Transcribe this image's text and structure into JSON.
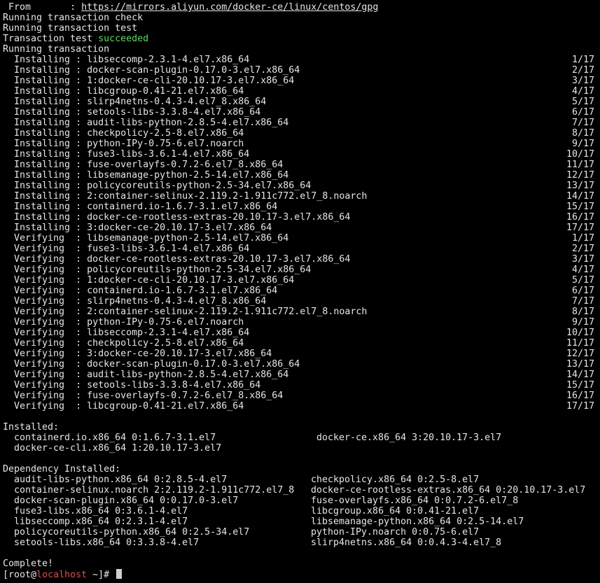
{
  "header_lines": {
    "from_label": " From       : ",
    "from_url": "https://mirrors.aliyun.com/docker-ce/linux/centos/gpg",
    "check": "Running transaction check",
    "test": "Running transaction test",
    "result_prefix": "Transaction test ",
    "result_status": "succeeded",
    "running": "Running transaction"
  },
  "transaction": [
    {
      "action": "Installing",
      "package": "libseccomp-2.3.1-4.el7.x86_64",
      "count": "1/17"
    },
    {
      "action": "Installing",
      "package": "docker-scan-plugin-0.17.0-3.el7.x86_64",
      "count": "2/17"
    },
    {
      "action": "Installing",
      "package": "1:docker-ce-cli-20.10.17-3.el7.x86_64",
      "count": "3/17"
    },
    {
      "action": "Installing",
      "package": "libcgroup-0.41-21.el7.x86_64",
      "count": "4/17"
    },
    {
      "action": "Installing",
      "package": "slirp4netns-0.4.3-4.el7_8.x86_64",
      "count": "5/17"
    },
    {
      "action": "Installing",
      "package": "setools-libs-3.3.8-4.el7.x86_64",
      "count": "6/17"
    },
    {
      "action": "Installing",
      "package": "audit-libs-python-2.8.5-4.el7.x86_64",
      "count": "7/17"
    },
    {
      "action": "Installing",
      "package": "checkpolicy-2.5-8.el7.x86_64",
      "count": "8/17"
    },
    {
      "action": "Installing",
      "package": "python-IPy-0.75-6.el7.noarch",
      "count": "9/17"
    },
    {
      "action": "Installing",
      "package": "fuse3-libs-3.6.1-4.el7.x86_64",
      "count": "10/17"
    },
    {
      "action": "Installing",
      "package": "fuse-overlayfs-0.7.2-6.el7_8.x86_64",
      "count": "11/17"
    },
    {
      "action": "Installing",
      "package": "libsemanage-python-2.5-14.el7.x86_64",
      "count": "12/17"
    },
    {
      "action": "Installing",
      "package": "policycoreutils-python-2.5-34.el7.x86_64",
      "count": "13/17"
    },
    {
      "action": "Installing",
      "package": "2:container-selinux-2.119.2-1.911c772.el7_8.noarch",
      "count": "14/17"
    },
    {
      "action": "Installing",
      "package": "containerd.io-1.6.7-3.1.el7.x86_64",
      "count": "15/17"
    },
    {
      "action": "Installing",
      "package": "docker-ce-rootless-extras-20.10.17-3.el7.x86_64",
      "count": "16/17"
    },
    {
      "action": "Installing",
      "package": "3:docker-ce-20.10.17-3.el7.x86_64",
      "count": "17/17"
    },
    {
      "action": "Verifying ",
      "package": "libsemanage-python-2.5-14.el7.x86_64",
      "count": "1/17"
    },
    {
      "action": "Verifying ",
      "package": "fuse3-libs-3.6.1-4.el7.x86_64",
      "count": "2/17"
    },
    {
      "action": "Verifying ",
      "package": "docker-ce-rootless-extras-20.10.17-3.el7.x86_64",
      "count": "3/17"
    },
    {
      "action": "Verifying ",
      "package": "policycoreutils-python-2.5-34.el7.x86_64",
      "count": "4/17"
    },
    {
      "action": "Verifying ",
      "package": "1:docker-ce-cli-20.10.17-3.el7.x86_64",
      "count": "5/17"
    },
    {
      "action": "Verifying ",
      "package": "containerd.io-1.6.7-3.1.el7.x86_64",
      "count": "6/17"
    },
    {
      "action": "Verifying ",
      "package": "slirp4netns-0.4.3-4.el7_8.x86_64",
      "count": "7/17"
    },
    {
      "action": "Verifying ",
      "package": "2:container-selinux-2.119.2-1.911c772.el7_8.noarch",
      "count": "8/17"
    },
    {
      "action": "Verifying ",
      "package": "python-IPy-0.75-6.el7.noarch",
      "count": "9/17"
    },
    {
      "action": "Verifying ",
      "package": "libseccomp-2.3.1-4.el7.x86_64",
      "count": "10/17"
    },
    {
      "action": "Verifying ",
      "package": "checkpolicy-2.5-8.el7.x86_64",
      "count": "11/17"
    },
    {
      "action": "Verifying ",
      "package": "3:docker-ce-20.10.17-3.el7.x86_64",
      "count": "12/17"
    },
    {
      "action": "Verifying ",
      "package": "docker-scan-plugin-0.17.0-3.el7.x86_64",
      "count": "13/17"
    },
    {
      "action": "Verifying ",
      "package": "audit-libs-python-2.8.5-4.el7.x86_64",
      "count": "14/17"
    },
    {
      "action": "Verifying ",
      "package": "setools-libs-3.3.8-4.el7.x86_64",
      "count": "15/17"
    },
    {
      "action": "Verifying ",
      "package": "fuse-overlayfs-0.7.2-6.el7_8.x86_64",
      "count": "16/17"
    },
    {
      "action": "Verifying ",
      "package": "libcgroup-0.41-21.el7.x86_64",
      "count": "17/17"
    }
  ],
  "installed": {
    "heading": "Installed:",
    "rows": [
      [
        "containerd.io.x86_64 0:1.6.7-3.1.el7",
        "docker-ce.x86_64 3:20.10.17-3.el7"
      ],
      [
        "docker-ce-cli.x86_64 1:20.10.17-3.el7",
        ""
      ]
    ]
  },
  "dependency_installed": {
    "heading": "Dependency Installed:",
    "rows": [
      [
        "audit-libs-python.x86_64 0:2.8.5-4.el7",
        "checkpolicy.x86_64 0:2.5-8.el7"
      ],
      [
        "container-selinux.noarch 2:2.119.2-1.911c772.el7_8",
        "docker-ce-rootless-extras.x86_64 0:20.10.17-3.el7"
      ],
      [
        "docker-scan-plugin.x86_64 0:0.17.0-3.el7",
        "fuse-overlayfs.x86_64 0:0.7.2-6.el7_8"
      ],
      [
        "fuse3-libs.x86_64 0:3.6.1-4.el7",
        "libcgroup.x86_64 0:0.41-21.el7"
      ],
      [
        "libseccomp.x86_64 0:2.3.1-4.el7",
        "libsemanage-python.x86_64 0:2.5-14.el7"
      ],
      [
        "policycoreutils-python.x86_64 0:2.5-34.el7",
        "python-IPy.noarch 0:0.75-6.el7"
      ],
      [
        "setools-libs.x86_64 0:3.3.8-4.el7",
        "slirp4netns.x86_64 0:0.4.3-4.el7_8"
      ]
    ]
  },
  "complete": "Complete!",
  "prompt": {
    "open": "[",
    "user": "root",
    "at": "@",
    "host": "localhost",
    "rest": " ~]# "
  },
  "colors": {
    "background": "#000000",
    "text": "#e6e6e6",
    "success": "#5fd75f",
    "host": "#e24b4b"
  }
}
